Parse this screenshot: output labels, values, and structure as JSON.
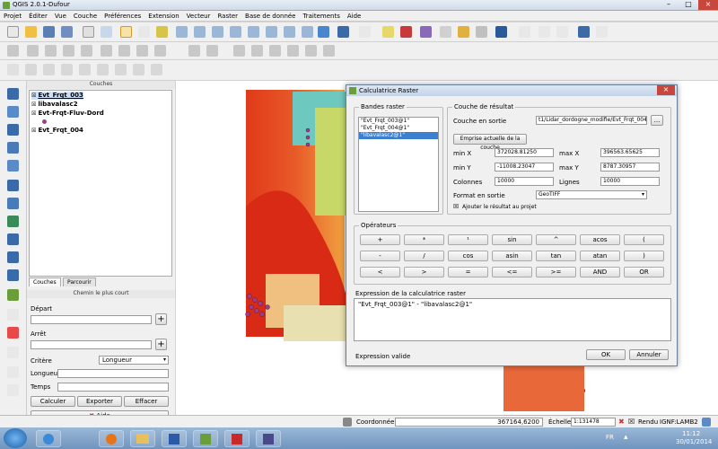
{
  "window": {
    "title": "QGIS 2.0.1-Dufour"
  },
  "menu": [
    "Projet",
    "Éditer",
    "Vue",
    "Couche",
    "Préférences",
    "Extension",
    "Vecteur",
    "Raster",
    "Base de donnée",
    "Traitements",
    "Aide"
  ],
  "layers_panel": {
    "title": "Couches",
    "layers": [
      "Evt_Frqt_003",
      "libavalasc2",
      "Evt-Frqt-Fluv-Dord",
      "Evt_Frqt_004"
    ]
  },
  "tabs": [
    "Couches",
    "Parcourir"
  ],
  "shortest_path": {
    "title": "Chemin le plus court",
    "depart_label": "Départ",
    "arret_label": "Arrêt",
    "critere_label": "Critère",
    "critere_value": "Longueur",
    "longueur_label": "Longueur",
    "temps_label": "Temps",
    "calculer": "Calculer",
    "exporter": "Exporter",
    "effacer": "Effacer",
    "aide": "Aide"
  },
  "dialog": {
    "title": "Calculatrice Raster",
    "bands_title": "Bandes raster",
    "bands": [
      "\"Evt_Frqt_003@1\"",
      "\"Evt_Frqt_004@1\"",
      "\"libavalasc2@1\""
    ],
    "result_title": "Couche de résultat",
    "output_label": "Couche en sortie",
    "output_value": "t1/Lidar_dordogne_modifie/Evt_Frqt_004.asc",
    "browse": "...",
    "extent_btn": "Emprise actuelle de la couche",
    "minx_label": "min X",
    "minx": "372028.81250",
    "maxx_label": "max X",
    "maxx": "396563.65625",
    "miny_label": "min Y",
    "miny": "-11008.23047",
    "maxy_label": "max Y",
    "maxy": "8787.30957",
    "cols_label": "Colonnes",
    "cols": "10000",
    "rows_label": "Lignes",
    "rows": "10000",
    "format_label": "Format en sortie",
    "format_value": "GeoTIFF",
    "add_result": "Ajouter le résultat au projet",
    "operators_title": "Opérateurs",
    "operators": [
      [
        "+",
        "*",
        "¹",
        "sin",
        "^",
        "acos",
        "("
      ],
      [
        "-",
        "/",
        "cos",
        "asin",
        "tan",
        "atan",
        ")"
      ],
      [
        "<",
        ">",
        "=",
        "<=",
        ">=",
        "AND",
        "OR"
      ]
    ],
    "expr_title": "Expression de la calculatrice raster",
    "expression": "\"Evt_Frqt_003@1\" - \"libavalasc2@1\"",
    "valid": "Expression valide",
    "ok": "OK",
    "cancel": "Annuler"
  },
  "status": {
    "coord_label": "Coordonnée :",
    "coord_value": "367164,6200",
    "scale_label": "Échelle",
    "scale_value": "1:131478",
    "render_label": "Rendu",
    "crs": "IGNF:LAMB2"
  },
  "taskbar": {
    "lang": "FR",
    "time": "11:12",
    "date": "30/01/2014"
  }
}
